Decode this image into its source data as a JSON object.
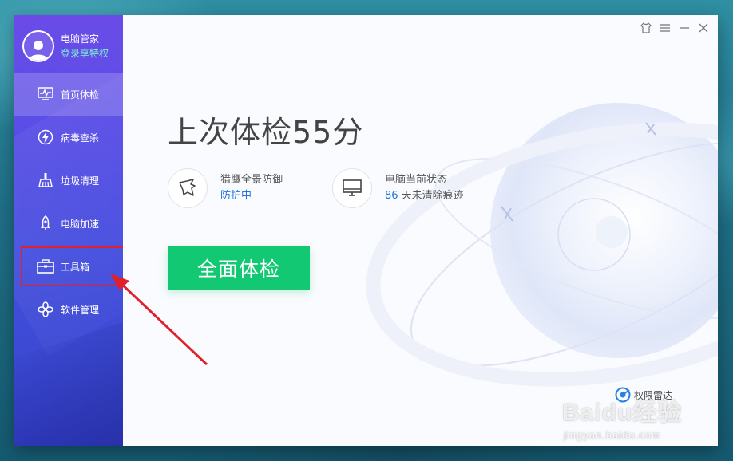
{
  "sidebar": {
    "profile": {
      "name": "电脑管家",
      "login": "登录享特权"
    },
    "items": [
      {
        "label": "首页体检",
        "icon": "monitor-pulse-icon",
        "active": true
      },
      {
        "label": "病毒查杀",
        "icon": "lightning-shield-icon",
        "active": false
      },
      {
        "label": "垃圾清理",
        "icon": "broom-icon",
        "active": false
      },
      {
        "label": "电脑加速",
        "icon": "rocket-icon",
        "active": false
      },
      {
        "label": "工具箱",
        "icon": "toolbox-icon",
        "active": false,
        "highlighted": true
      },
      {
        "label": "软件管理",
        "icon": "apps-icon",
        "active": false
      }
    ]
  },
  "main": {
    "title": "上次体检55分",
    "status_cards": [
      {
        "label": "猎鹰全景防御",
        "value": "防护中",
        "icon": "falcon-icon"
      },
      {
        "label": "电脑当前状态",
        "value_num": "86",
        "value_text": " 天未清除痕迹",
        "icon": "monitor-icon"
      }
    ],
    "scan_button": "全面体检",
    "radar": "权限雷达"
  },
  "window_controls": [
    "skin-icon",
    "menu-icon",
    "minimize-icon",
    "close-icon"
  ],
  "watermark": {
    "brand": "Baidu经验",
    "url": "jingyan.baidu.com"
  },
  "colors": {
    "accent_green": "#12c873",
    "link_blue": "#1f74e0",
    "highlight_red": "#e0212c",
    "sidebar_purple": "#5a4ee6"
  }
}
